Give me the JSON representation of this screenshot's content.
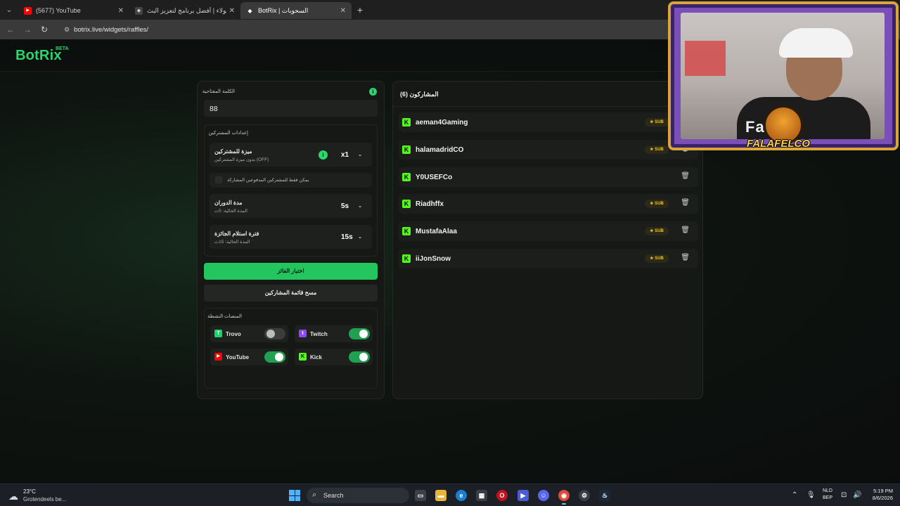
{
  "browser": {
    "tabs": [
      {
        "title": "(5677) YouTube",
        "fav_color": "#ff0000",
        "fav_glyph": "▶"
      },
      {
        "title": "الولاء | أفضل برنامج لتعزيز البث",
        "fav_color": "#333333",
        "fav_glyph": "◈"
      },
      {
        "title": "BotRix | السحوبات",
        "fav_color": "#2a2a2a",
        "fav_glyph": "◆"
      }
    ],
    "new_tab_icon": "+",
    "url": "botrix.live/widgets/raffles/"
  },
  "brand": {
    "name": "BotRix",
    "beta": "BETA",
    "color": "#2bd66a"
  },
  "raffle": {
    "keyword_label": "الكلمة المفتاحية",
    "keyword_value": "88",
    "subs_section_title": "إعدادات المشتركين",
    "sub_bonus": {
      "title": "ميزة للمشتركين",
      "subtitle": "بدون ميزة المشتركين (OFF)",
      "value": "x1"
    },
    "subs_only_label": "يمكن فقط للمشتركين المدفوعين المشاركة",
    "rotation": {
      "title": "مدة الدوران",
      "subtitle": "المدة الحالية: 5ث",
      "value": "5s"
    },
    "claim": {
      "title": "فترة استلام الجائزة",
      "subtitle": "المدة الحالية: 15ث",
      "value": "15s"
    },
    "pick_winner": "اختيار الفائز",
    "clear_list": "مسح قائمة المشاركين",
    "platforms_title": "المنصات النشطة",
    "platforms": [
      {
        "name": "Trovo",
        "enabled": false,
        "color": "#19d66b",
        "glyph": "T"
      },
      {
        "name": "Twitch",
        "enabled": true,
        "color": "#9146ff",
        "glyph": "t"
      },
      {
        "name": "YouTube",
        "enabled": true,
        "color": "#ff0000",
        "glyph": "▶"
      },
      {
        "name": "Kick",
        "enabled": true,
        "color": "#53fc18",
        "glyph": "K"
      }
    ]
  },
  "participants": {
    "title": "المشاركون (6)",
    "badge_label": "★ SUB",
    "items": [
      {
        "name": "aeman4Gaming",
        "sub": true
      },
      {
        "name": "halamadridCO",
        "sub": true
      },
      {
        "name": "Y0USEFCo",
        "sub": false
      },
      {
        "name": "Riadhffx",
        "sub": true
      },
      {
        "name": "MustafaAlaa",
        "sub": true
      },
      {
        "name": "iiJonSnow",
        "sub": true
      }
    ]
  },
  "webcam": {
    "overlay_text": "Fa     lco",
    "channel_name": "FALAFELCO"
  },
  "taskbar": {
    "weather_temp": "23°C",
    "weather_desc": "Grotendeels be...",
    "search_label": "Search",
    "lang_top": "NLD",
    "lang_bottom": "BEP",
    "time": "5:19 PM",
    "date": "8/6/2026"
  }
}
